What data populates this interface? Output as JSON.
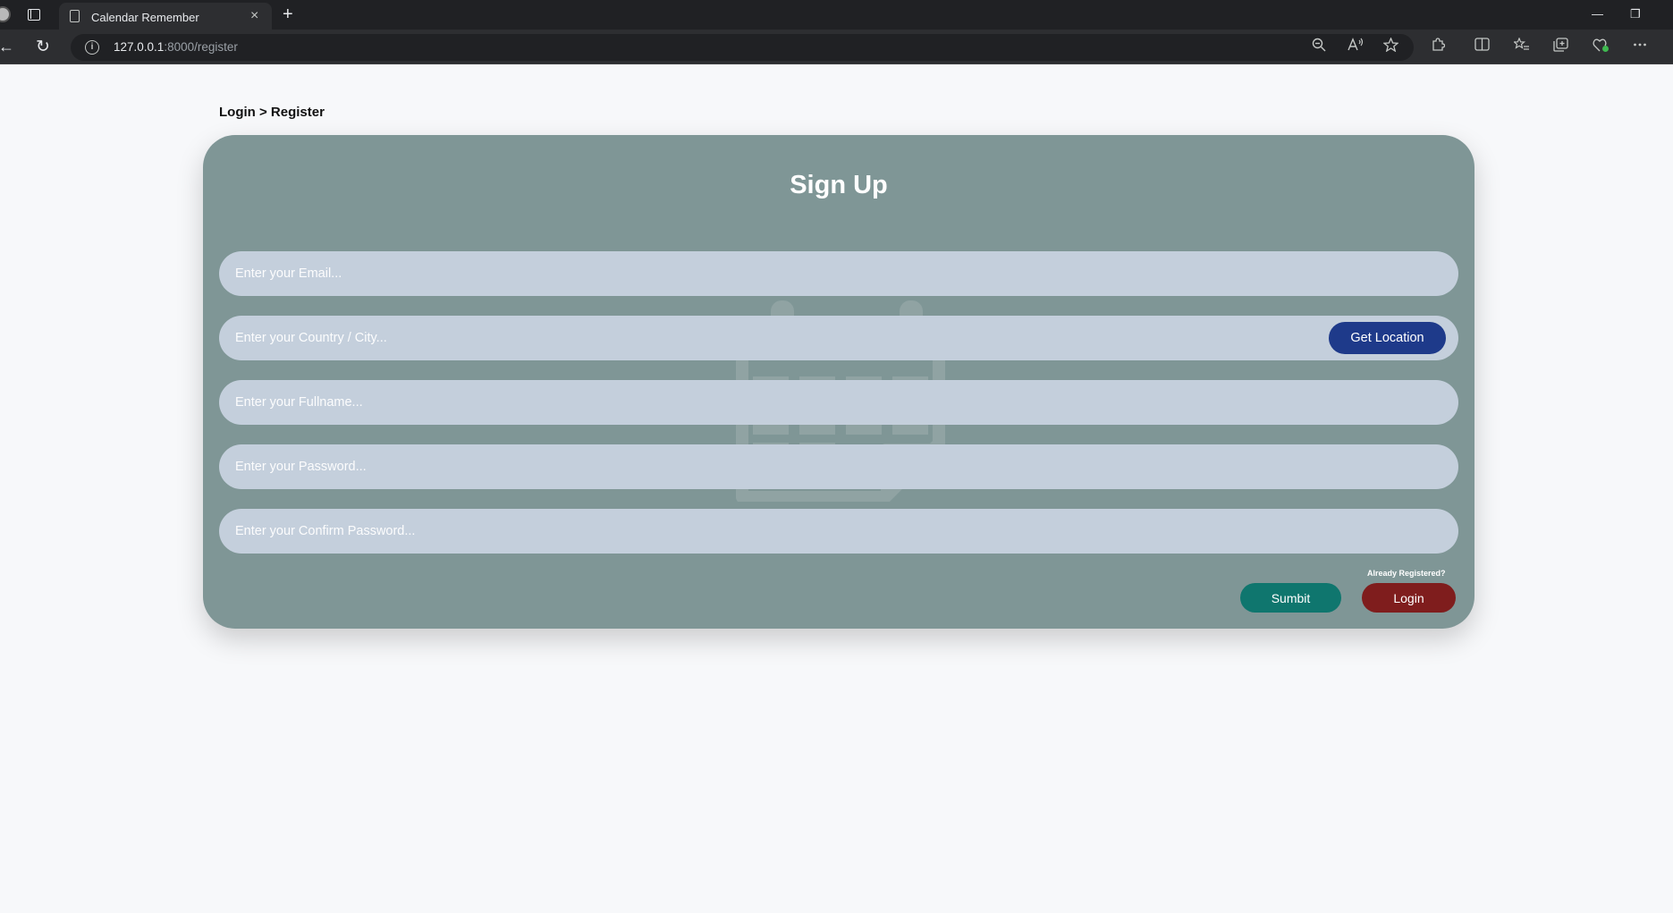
{
  "browser": {
    "tab_title": "Calendar Remember",
    "tab_close": "×",
    "new_tab": "+",
    "url_host": "127.0.0.1",
    "url_rest": ":8000/register",
    "back": "←",
    "reload": "↻",
    "win_minimize": "—",
    "win_restore": "❐"
  },
  "breadcrumb": "Login > Register",
  "form": {
    "title": "Sign Up",
    "email_placeholder": "Enter your Email...",
    "location_placeholder": "Enter your Country / City...",
    "get_location_label": "Get Location",
    "fullname_placeholder": "Enter your Fullname...",
    "password_placeholder": "Enter your Password...",
    "confirm_placeholder": "Enter your Confirm Password...",
    "already_registered": "Already Registered?",
    "submit_label": "Sumbit",
    "login_label": "Login"
  },
  "colors": {
    "card": "#7f9696",
    "field": "#c4cfdc",
    "get_location": "#1e3a8a",
    "submit": "#0f766e",
    "login": "#7f1d1d"
  }
}
